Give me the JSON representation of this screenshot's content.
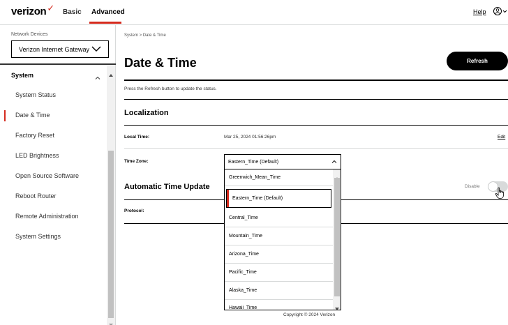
{
  "header": {
    "logo": "verizon",
    "nav_basic": "Basic",
    "nav_advanced": "Advanced",
    "help": "Help",
    "user_icon": "user-circle-icon",
    "accent_color": "#d52b1e"
  },
  "sidebar": {
    "network_devices_label": "Network Devices",
    "device_select_value": "Verizon Internet Gateway",
    "section_label": "System",
    "items": [
      {
        "label": "System Status"
      },
      {
        "label": "Date & Time"
      },
      {
        "label": "Factory Reset"
      },
      {
        "label": "LED Brightness"
      },
      {
        "label": "Open Source Software"
      },
      {
        "label": "Reboot Router"
      },
      {
        "label": "Remote Administration"
      },
      {
        "label": "System Settings"
      }
    ],
    "active_item": "Date & Time"
  },
  "main": {
    "breadcrumb": "System  >  Date & Time",
    "title": "Date & Time",
    "refresh_button": "Refresh",
    "description": "Press the Refresh button to update the status.",
    "localization_title": "Localization",
    "local_time_label": "Local Time:",
    "local_time_value": "Mar 25, 2024 01:56:26pm",
    "edit_link": "Edit",
    "time_zone_label": "Time Zone:",
    "time_zone_value": "Eastern_Time (Default)",
    "auto_update_title": "Automatic Time Update",
    "toggle_label": "Disable",
    "toggle_state": "off",
    "protocol_label": "Protocol:"
  },
  "timezone_dropdown": {
    "options": [
      "Greenwich_Mean_Time",
      "Eastern_Time (Default)",
      "Central_Time",
      "Mountain_Time",
      "Arizona_Time",
      "Pacific_Time",
      "Alaska_Time",
      "Hawaii_Time"
    ],
    "selected": "Eastern_Time (Default)"
  },
  "footer": {
    "copyright": "Copyright © 2024 Verizon"
  }
}
